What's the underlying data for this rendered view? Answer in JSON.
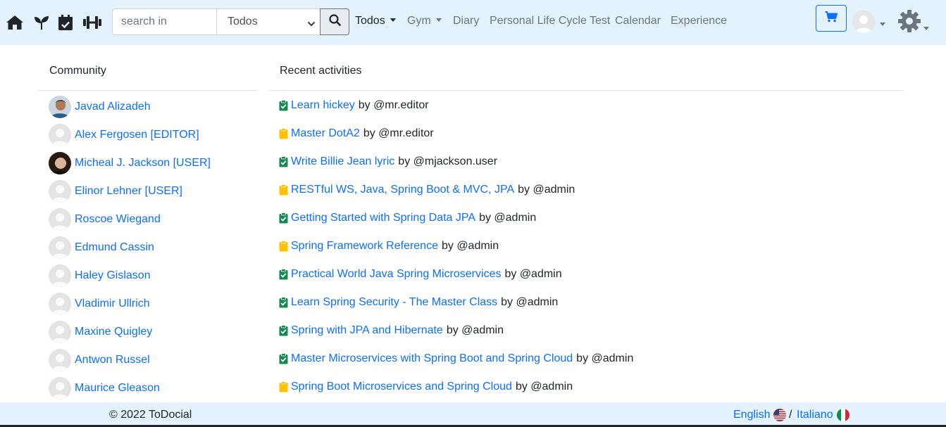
{
  "navbar": {
    "icons": [
      "home-icon",
      "seedling-icon",
      "calendar-check-icon",
      "dumbbell-icon"
    ],
    "search": {
      "placeholder": "search in",
      "selected": "Todos"
    },
    "links": [
      {
        "label": "Todos",
        "dropdown": true,
        "active": true
      },
      {
        "label": "Gym",
        "dropdown": true,
        "active": false
      },
      {
        "label": "Diary",
        "dropdown": false,
        "active": false
      },
      {
        "label": "Personal Life Cycle Test",
        "dropdown": false,
        "active": false
      },
      {
        "label": "Calendar",
        "dropdown": false,
        "active": false
      },
      {
        "label": "Experience",
        "dropdown": false,
        "active": false
      }
    ]
  },
  "community": {
    "title": "Community",
    "users": [
      {
        "name": "Javad Alizadeh",
        "avatar": "photo-man"
      },
      {
        "name": "Alex Fergosen [EDITOR]",
        "avatar": "default"
      },
      {
        "name": "Micheal J. Jackson [USER]",
        "avatar": "photo-jackson"
      },
      {
        "name": "Elinor Lehner [USER]",
        "avatar": "default"
      },
      {
        "name": "Roscoe Wiegand",
        "avatar": "default"
      },
      {
        "name": "Edmund Cassin",
        "avatar": "default"
      },
      {
        "name": "Haley Gislason",
        "avatar": "default"
      },
      {
        "name": "Vladimir Ullrich",
        "avatar": "default"
      },
      {
        "name": "Maxine Quigley",
        "avatar": "default"
      },
      {
        "name": "Antwon Russel",
        "avatar": "default"
      },
      {
        "name": "Maurice Gleason",
        "avatar": "default"
      }
    ]
  },
  "activities": {
    "title": "Recent activities",
    "items": [
      {
        "title": "Learn hickey",
        "by": "by @mr.editor",
        "status": "done"
      },
      {
        "title": "Master DotA2",
        "by": "by @mr.editor",
        "status": "pending"
      },
      {
        "title": "Write Billie Jean lyric",
        "by": "by @mjackson.user",
        "status": "done"
      },
      {
        "title": "RESTful WS, Java, Spring Boot & MVC, JPA",
        "by": "by @admin",
        "status": "pending"
      },
      {
        "title": "Getting Started with Spring Data JPA",
        "by": "by @admin",
        "status": "done"
      },
      {
        "title": "Spring Framework Reference",
        "by": "by @admin",
        "status": "pending"
      },
      {
        "title": "Practical World Java Spring Microservices",
        "by": "by @admin",
        "status": "done"
      },
      {
        "title": "Learn Spring Security - The Master Class",
        "by": "by @admin",
        "status": "done"
      },
      {
        "title": "Spring with JPA and Hibernate",
        "by": "by @admin",
        "status": "done"
      },
      {
        "title": "Master Microservices with Spring Boot and Spring Cloud",
        "by": "by @admin",
        "status": "done"
      },
      {
        "title": "Spring Boot Microservices and Spring Cloud",
        "by": "by @admin",
        "status": "pending"
      }
    ]
  },
  "footer": {
    "copyright": "© 2022 ToDocial",
    "lang_en": "English",
    "separator": "/",
    "lang_it": "Italiano"
  },
  "colors": {
    "navbar_bg": "#e3f2fd",
    "link": "#0d6efd",
    "done": "#198754",
    "pending": "#ffc107"
  }
}
